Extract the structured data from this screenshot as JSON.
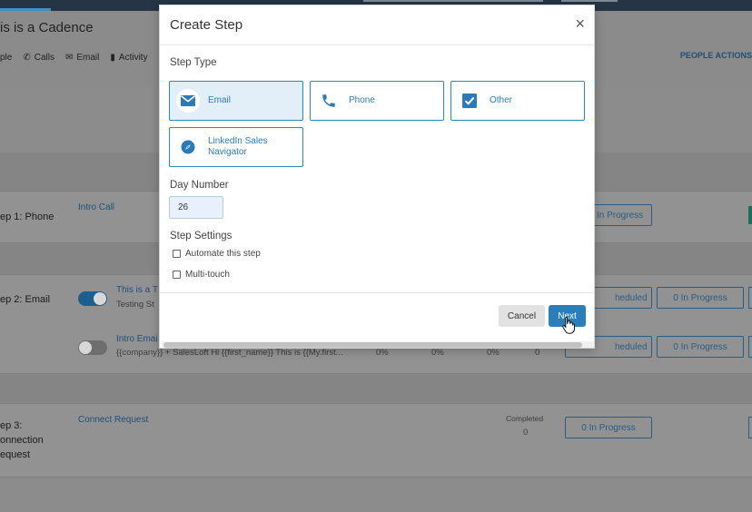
{
  "background": {
    "page_title": "is is a Cadence",
    "tabs": [
      {
        "icon": "people-icon",
        "label": "ple"
      },
      {
        "icon": "phone-icon",
        "glyph": "✆",
        "label": "Calls"
      },
      {
        "icon": "mail-icon",
        "glyph": "✉",
        "label": "Email"
      },
      {
        "icon": "bar-chart-icon",
        "glyph": "▮",
        "label": "Activity"
      }
    ],
    "people_actions": "PEOPLE ACTIONS",
    "steps": [
      {
        "label": "ep 1: Phone",
        "link": "Intro Call",
        "button": "In Progress"
      },
      {
        "label": "ep 2: Email",
        "link1": "This is a T",
        "sub1": "Testing St",
        "link2": "Intro Emai",
        "sub2": "{{company}} + SalesLoft Hi {{first_name}}   This is {{My.first...",
        "stats": [
          "0%",
          "0%",
          "0%",
          "0"
        ],
        "btn_scheduled": "heduled",
        "btn_progress": "0 In Progress"
      },
      {
        "label_lines": [
          "ep 3:",
          "onnection",
          "equest"
        ],
        "link": "Connect Request",
        "completed_label": "Completed",
        "completed_value": "0",
        "button": "0 In Progress"
      }
    ]
  },
  "modal": {
    "title": "Create Step",
    "close_glyph": "×",
    "step_type_label": "Step Type",
    "step_types": [
      {
        "label": "Email",
        "icon": "mail-icon",
        "selected": true
      },
      {
        "label": "Phone",
        "icon": "phone-icon",
        "selected": false
      },
      {
        "label": "Other",
        "icon": "checkbox-icon",
        "selected": false
      },
      {
        "label": "LinkedIn Sales Navigator",
        "icon": "compass-icon",
        "selected": false
      }
    ],
    "day_number_label": "Day Number",
    "day_number_value": "26",
    "step_settings_label": "Step Settings",
    "settings": [
      {
        "label": "Automate this step",
        "checked": false
      },
      {
        "label": "Multi-touch",
        "checked": false
      }
    ],
    "cancel_label": "Cancel",
    "next_label": "Next"
  },
  "colors": {
    "accent": "#2a7fba",
    "selected_card_bg": "#e3eff8",
    "overlay_bg": "#8c8c8c"
  }
}
